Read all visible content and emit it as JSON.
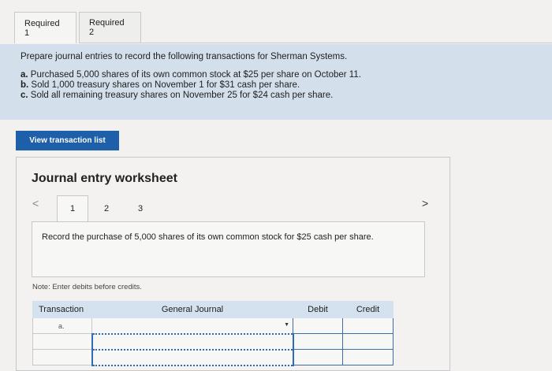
{
  "tabs": [
    {
      "label": "Required 1"
    },
    {
      "label": "Required 2"
    }
  ],
  "instructions": {
    "prompt": "Prepare journal entries to record the following transactions for Sherman Systems.",
    "items": [
      {
        "letter": "a.",
        "text": " Purchased 5,000 shares of its own common stock at $25 per share on October 11."
      },
      {
        "letter": "b.",
        "text": " Sold 1,000 treasury shares on November 1 for $31 cash per share."
      },
      {
        "letter": "c.",
        "text": " Sold all remaining treasury shares on November 25 for $24 cash per share."
      }
    ]
  },
  "view_button": "View transaction list",
  "worksheet": {
    "title": "Journal entry worksheet",
    "prev": "<",
    "next": ">",
    "pages": [
      "1",
      "2",
      "3"
    ],
    "description": "Record the purchase of 5,000 shares of its own common stock for $25 cash per share.",
    "note": "Note: Enter debits before credits."
  },
  "journal": {
    "headers": {
      "transaction": "Transaction",
      "account": "General Journal",
      "debit": "Debit",
      "credit": "Credit"
    },
    "rows": [
      {
        "transaction": "a.",
        "account": "",
        "debit": "",
        "credit": ""
      },
      {
        "transaction": "",
        "account": "",
        "debit": "",
        "credit": ""
      },
      {
        "transaction": "",
        "account": "",
        "debit": "",
        "credit": ""
      }
    ]
  }
}
